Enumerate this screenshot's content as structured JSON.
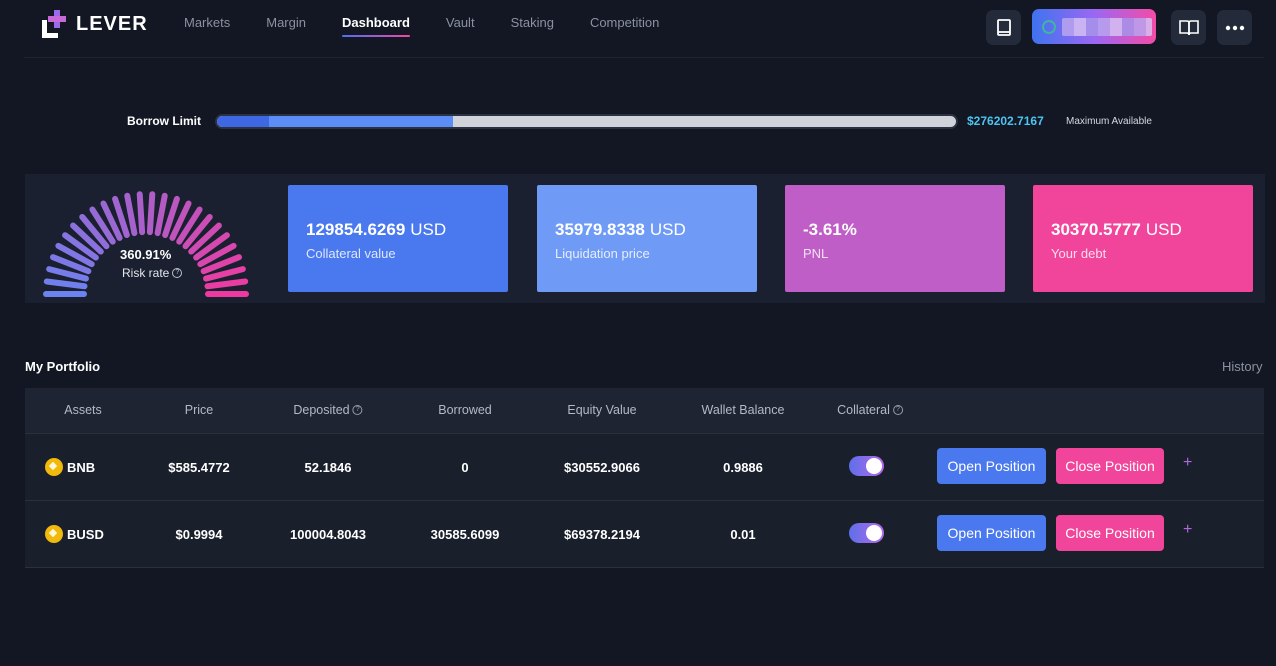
{
  "brand": {
    "name": "LEVER"
  },
  "nav": {
    "items": [
      {
        "label": "Markets",
        "active": false
      },
      {
        "label": "Margin",
        "active": false
      },
      {
        "label": "Dashboard",
        "active": true
      },
      {
        "label": "Vault",
        "active": false
      },
      {
        "label": "Staking",
        "active": false
      },
      {
        "label": "Competition",
        "active": false
      }
    ]
  },
  "header_icons": {
    "docs": "book-icon",
    "guide": "open-book-icon",
    "more": "more-dots-icon"
  },
  "borrow": {
    "label": "Borrow Limit",
    "value": "$276202.7167",
    "caption": "Maximum Available",
    "used_fraction": 0.32
  },
  "risk": {
    "value": "360.91%",
    "label": "Risk rate"
  },
  "cards": [
    {
      "value": "129854.6269",
      "unit": "USD",
      "label": "Collateral value",
      "color": "#4a78ef"
    },
    {
      "value": "35979.8338",
      "unit": "USD",
      "label": "Liquidation price",
      "color": "#6f9bf7"
    },
    {
      "value": "-3.61%",
      "unit": "",
      "label": "PNL",
      "color": "#be5ec6"
    },
    {
      "value": "30370.5777",
      "unit": "USD",
      "label": "Your debt",
      "color": "#f0459a"
    }
  ],
  "portfolio": {
    "title": "My Portfolio",
    "history": "History",
    "headers": [
      "Assets",
      "Price",
      "Deposited",
      "Borrowed",
      "Equity Value",
      "Wallet Balance",
      "Collateral"
    ],
    "rows": [
      {
        "asset": "BNB",
        "price": "$585.4772",
        "deposited": "52.1846",
        "borrowed": "0",
        "equity": "$30552.9066",
        "wallet": "0.9886",
        "collateral": true,
        "open": "Open Position",
        "close": "Close Position",
        "plus": "+"
      },
      {
        "asset": "BUSD",
        "price": "$0.9994",
        "deposited": "100004.8043",
        "borrowed": "30585.6099",
        "equity": "$69378.2194",
        "wallet": "0.01",
        "collateral": true,
        "open": "Open Position",
        "close": "Close Position",
        "plus": "+"
      }
    ]
  },
  "colors": {
    "accent_blue": "#4a78ef",
    "accent_pink": "#f0459a",
    "background": "#121723",
    "link_cyan": "#4ec3f0"
  }
}
